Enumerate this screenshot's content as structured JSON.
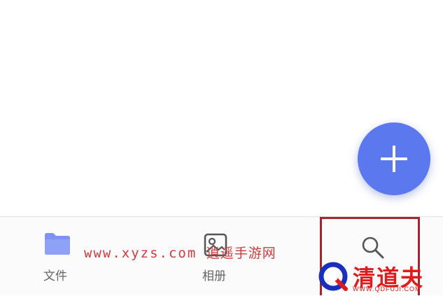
{
  "fab": {
    "icon": "plus-icon",
    "color": "#5b78ee"
  },
  "bottom_nav": {
    "items": [
      {
        "id": "files",
        "label": "文件",
        "icon": "folder-icon"
      },
      {
        "id": "album",
        "label": "相册",
        "icon": "photo-album-icon"
      },
      {
        "id": "search",
        "label": "",
        "icon": "search-icon",
        "highlighted": true
      }
    ]
  },
  "watermarks": {
    "site_text": "www.xyzs.com",
    "site_name": "逍遥手游网",
    "logo_text": "清道夫",
    "logo_url": "WWW.QDFUJI.COM"
  },
  "colors": {
    "accent": "#5b78ee",
    "highlight_border": "#a3262c",
    "watermark_red": "#e01b1b"
  }
}
